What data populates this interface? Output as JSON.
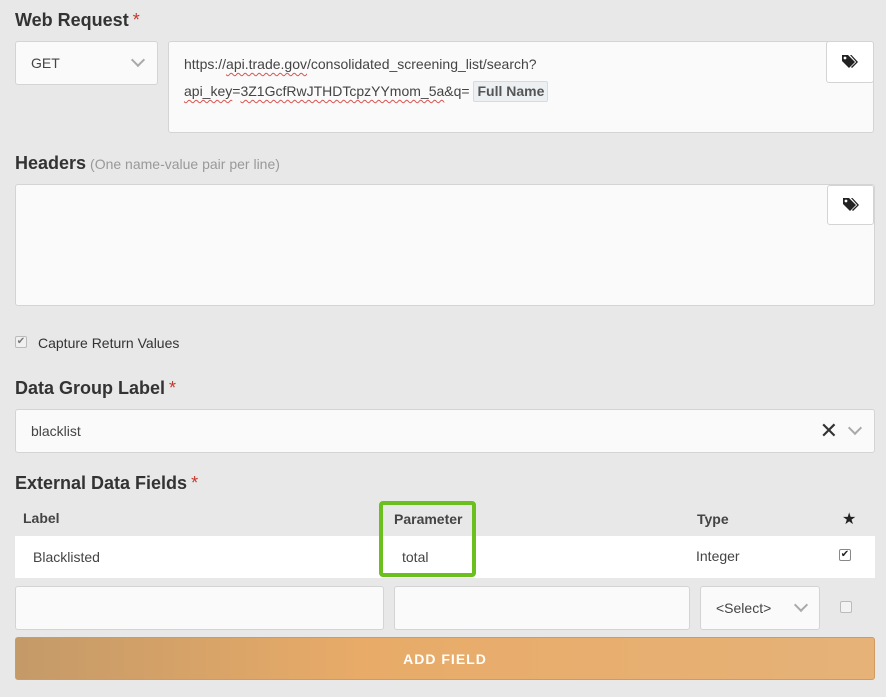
{
  "web_request": {
    "label": "Web Request",
    "required_mark": "*",
    "method": "GET",
    "url_part1": "https://",
    "url_part2": "api.trade.gov",
    "url_part3": "/consolidated_screening_list/search?",
    "url_part4": "api_key",
    "url_part5": "=",
    "url_part6": "3Z1GcfRwJTHDTcpzYYmom_5a",
    "url_part7": "&q=",
    "token": "Full Name",
    "tag_icon": "tags-icon"
  },
  "headers": {
    "label": "Headers",
    "hint": "(One name-value pair per line)",
    "value": "",
    "tag_icon": "tags-icon"
  },
  "capture": {
    "label": "Capture Return Values",
    "checked": true
  },
  "data_group": {
    "label": "Data Group Label",
    "required_mark": "*",
    "value": "blacklist",
    "clear_icon": "close-icon",
    "chevron_icon": "chevron-down-icon"
  },
  "external_fields": {
    "label": "External Data Fields",
    "required_mark": "*",
    "columns": {
      "label": "Label",
      "parameter": "Parameter",
      "type": "Type",
      "star": "★"
    },
    "rows": [
      {
        "label": "Blacklisted",
        "parameter": "total",
        "type": "Integer",
        "key": true
      }
    ],
    "new_row": {
      "label_value": "",
      "parameter_value": "",
      "type_value": "<Select>",
      "key": false
    },
    "highlight_color": "#6bbf1f",
    "add_button": "ADD FIELD"
  },
  "colors": {
    "background": "#e8e8e8",
    "required": "#c0392b",
    "button_gradient_start": "#c49a68",
    "button_gradient_end": "#e6b278"
  }
}
